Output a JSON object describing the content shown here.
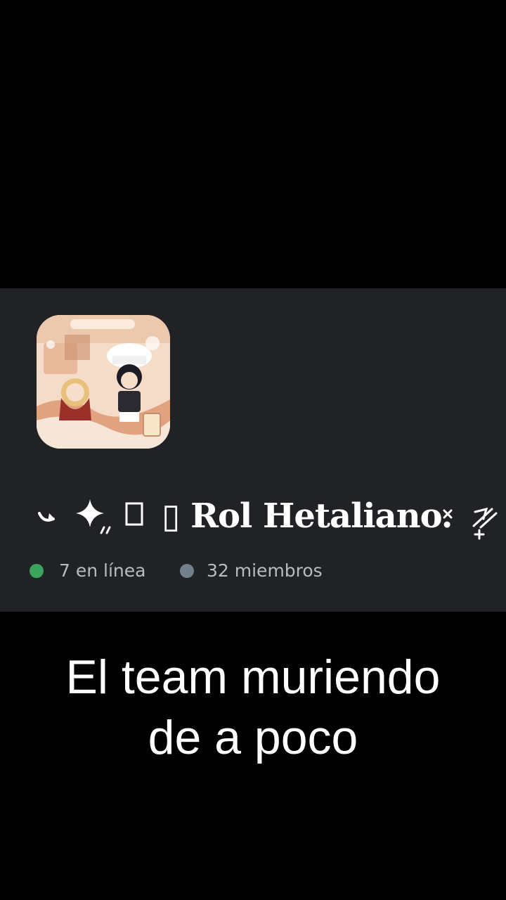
{
  "server": {
    "icon": "server-avatar-chibi-art",
    "name_prefix_deco": "↪✦„",
    "name": "▯ Rol Hetaliano.",
    "name_suffix_deco": "×⁄⁄+",
    "online": {
      "label": "7 en línea",
      "dot_color": "#3ba55c"
    },
    "members": {
      "label": "32 miembros",
      "dot_color": "#747f8d"
    }
  },
  "caption": {
    "line1": "El team muriendo",
    "line2": "de a poco"
  },
  "colors": {
    "background": "#000000",
    "card": "#202225",
    "text_muted": "#b9bbbe",
    "text_primary": "#ffffff"
  }
}
